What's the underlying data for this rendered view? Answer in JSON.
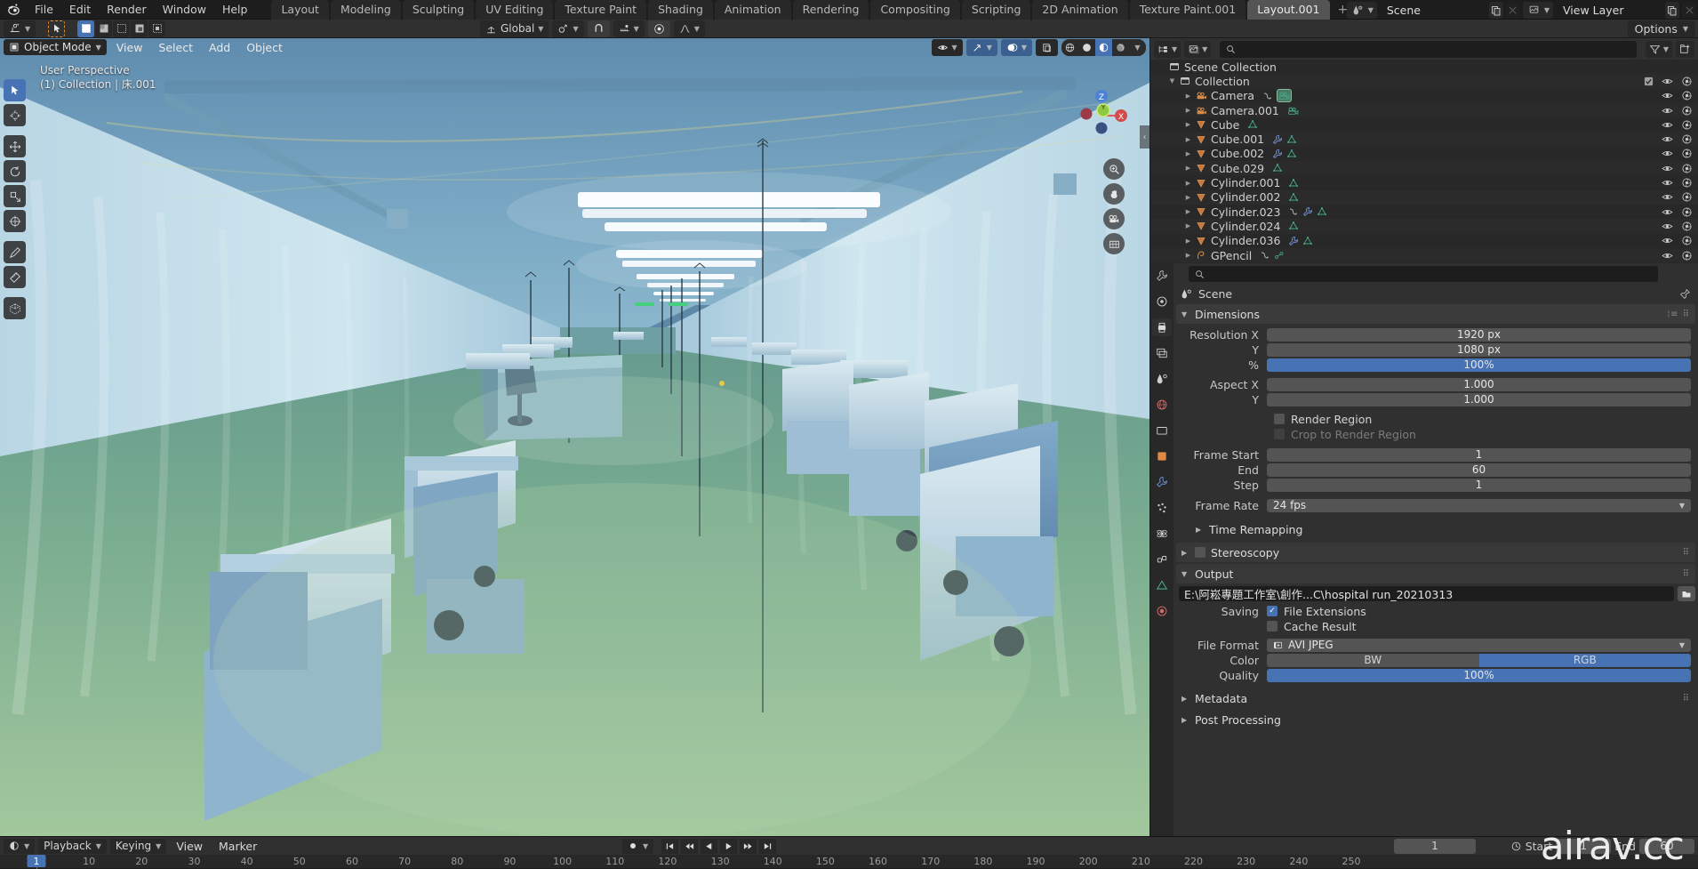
{
  "app": {
    "logo_icon": "blender-logo-icon",
    "menus": [
      "File",
      "Edit",
      "Render",
      "Window",
      "Help"
    ],
    "workspace_tabs": [
      {
        "label": "Layout",
        "active": false
      },
      {
        "label": "Modeling",
        "active": false
      },
      {
        "label": "Sculpting",
        "active": false
      },
      {
        "label": "UV Editing",
        "active": false
      },
      {
        "label": "Texture Paint",
        "active": false
      },
      {
        "label": "Shading",
        "active": false
      },
      {
        "label": "Animation",
        "active": false
      },
      {
        "label": "Rendering",
        "active": false
      },
      {
        "label": "Compositing",
        "active": false
      },
      {
        "label": "Scripting",
        "active": false
      },
      {
        "label": "2D Animation",
        "active": false
      },
      {
        "label": "Texture Paint.001",
        "active": false
      },
      {
        "label": "Layout.001",
        "active": true
      }
    ],
    "add_workspace_label": "+",
    "scene_name": "Scene",
    "view_layer_name": "View Layer",
    "scene_icon": "scene-data-icon",
    "view_layer_icon": "view-layer-icon",
    "new_icon": "duplicate-icon",
    "close_icon": "x-icon"
  },
  "toolsettings": {
    "active_tool_icon": "cursor-tool-icon",
    "select_modes": [
      "set",
      "extend",
      "subtract",
      "invert",
      "intersect"
    ],
    "transform_orientation": "Global",
    "snap_icon": "magnet-icon",
    "pivot_icon": "pivot-icon",
    "proportional_icon": "proportional-edit-icon",
    "falloff_icon": "falloff-curve-icon",
    "options_label": "Options"
  },
  "viewport": {
    "mode": "Object Mode",
    "mode_icon": "object-mode-icon",
    "menus": [
      "View",
      "Select",
      "Add",
      "Object"
    ],
    "overlay_text_line1": "User Perspective",
    "overlay_text_line2": "(1) Collection | 床.001",
    "gizmo_axes": [
      "X",
      "Y",
      "Z"
    ],
    "nav_buttons": [
      "zoom-icon",
      "pan-hand-icon",
      "camera-view-icon",
      "toggle-ortho-icon"
    ],
    "shading_modes": [
      "wireframe",
      "solid",
      "material-preview",
      "rendered"
    ],
    "active_shading": "material-preview",
    "left_tools": [
      {
        "name": "tweak-select-tool",
        "active": true
      },
      {
        "name": "cursor-tool",
        "active": false
      },
      {
        "name": "move-tool",
        "active": false
      },
      {
        "name": "rotate-tool",
        "active": false
      },
      {
        "name": "scale-tool",
        "active": false
      },
      {
        "name": "transform-tool",
        "active": false
      },
      {
        "name": "annotate-tool",
        "active": false
      },
      {
        "name": "measure-tool",
        "active": false
      },
      {
        "name": "add-cube-tool",
        "active": false
      }
    ]
  },
  "outliner": {
    "display_mode_icon": "outliner-display-icon",
    "filter_id_icon": "blender-file-icon",
    "search_placeholder": "",
    "filter_icon": "funnel-icon",
    "new_collection_icon": "new-collection-icon",
    "root": "Scene Collection",
    "collection": {
      "label": "Collection",
      "checkbox": true,
      "eye": true,
      "camera": true
    },
    "items": [
      {
        "name": "Camera",
        "icon": "camera-data-icon",
        "extras": [
          "animation-icon",
          "camera-object-icon"
        ],
        "highlight": true
      },
      {
        "name": "Camera.001",
        "icon": "camera-data-icon",
        "extras": [
          "camera-object-icon"
        ],
        "highlight": false
      },
      {
        "name": "Cube",
        "icon": "mesh-icon",
        "extras": [
          "mesh-data-icon"
        ],
        "highlight": false
      },
      {
        "name": "Cube.001",
        "icon": "mesh-icon",
        "extras": [
          "modifier-wrench-icon",
          "mesh-data-icon"
        ],
        "highlight": false
      },
      {
        "name": "Cube.002",
        "icon": "mesh-icon",
        "extras": [
          "modifier-wrench-icon",
          "mesh-data-icon"
        ],
        "highlight": false
      },
      {
        "name": "Cube.029",
        "icon": "mesh-icon",
        "extras": [
          "mesh-data-icon"
        ],
        "highlight": false
      },
      {
        "name": "Cylinder.001",
        "icon": "mesh-icon",
        "extras": [
          "mesh-data-icon"
        ],
        "highlight": false
      },
      {
        "name": "Cylinder.002",
        "icon": "mesh-icon",
        "extras": [
          "mesh-data-icon"
        ],
        "highlight": false
      },
      {
        "name": "Cylinder.023",
        "icon": "mesh-icon",
        "extras": [
          "animation-icon",
          "modifier-wrench-icon",
          "mesh-data-icon"
        ],
        "highlight": false
      },
      {
        "name": "Cylinder.024",
        "icon": "mesh-icon",
        "extras": [
          "mesh-data-icon"
        ],
        "highlight": false
      },
      {
        "name": "Cylinder.036",
        "icon": "mesh-icon",
        "extras": [
          "modifier-wrench-icon",
          "mesh-data-icon"
        ],
        "highlight": false
      },
      {
        "name": "GPencil",
        "icon": "gpencil-icon",
        "extras": [
          "animation-icon",
          "gpencil-data-icon"
        ],
        "highlight": false
      }
    ]
  },
  "properties": {
    "search_placeholder": "",
    "breadcrumb": "Scene",
    "breadcrumb_icon": "scene-icon",
    "pin_icon": "pin-icon",
    "tabs": [
      {
        "name": "tool-tab",
        "icon": "tool-icon",
        "active": false
      },
      {
        "name": "render-tab",
        "icon": "camera-back-icon",
        "active": false
      },
      {
        "name": "output-tab",
        "icon": "printer-icon",
        "active": true
      },
      {
        "name": "view-layer-tab",
        "icon": "images-icon",
        "active": false
      },
      {
        "name": "scene-tab",
        "icon": "scene-cone-icon",
        "active": false
      },
      {
        "name": "world-tab",
        "icon": "world-globe-icon",
        "active": false
      },
      {
        "name": "collection-tab",
        "icon": "collection-box-icon",
        "active": false
      },
      {
        "name": "object-tab",
        "icon": "orange-square-icon",
        "active": false
      },
      {
        "name": "modifier-tab",
        "icon": "wrench-icon",
        "active": false
      },
      {
        "name": "particles-tab",
        "icon": "particles-icon",
        "active": false
      },
      {
        "name": "physics-tab",
        "icon": "physics-orbit-icon",
        "active": false
      },
      {
        "name": "constraint-tab",
        "icon": "constraint-icon",
        "active": false
      },
      {
        "name": "data-tab",
        "icon": "green-triangle-icon",
        "active": false
      },
      {
        "name": "material-tab",
        "icon": "material-sphere-icon",
        "active": false
      }
    ],
    "dimensions": {
      "title": "Dimensions",
      "rows": [
        {
          "label": "Resolution X",
          "value": "1920 px",
          "style": "normal"
        },
        {
          "label": "Y",
          "value": "1080 px",
          "style": "normal"
        },
        {
          "label": "%",
          "value": "100%",
          "style": "slider"
        },
        {
          "label": "Aspect X",
          "value": "1.000",
          "style": "normal"
        },
        {
          "label": "Y",
          "value": "1.000",
          "style": "normal"
        }
      ],
      "checks": [
        {
          "label": "Render Region",
          "checked": false,
          "disabled": false
        },
        {
          "label": "Crop to Render Region",
          "checked": false,
          "disabled": true
        }
      ],
      "frames": [
        {
          "label": "Frame Start",
          "value": "1"
        },
        {
          "label": "End",
          "value": "60"
        },
        {
          "label": "Step",
          "value": "1"
        }
      ],
      "frame_rate_label": "Frame Rate",
      "frame_rate_value": "24 fps"
    },
    "time_remapping": "Time Remapping",
    "stereoscopy": {
      "label": "Stereoscopy",
      "checked": false
    },
    "output": {
      "title": "Output",
      "path": "E:\\阿崧專題工作室\\創作...C\\hospital run_20210313",
      "folder_icon": "folder-icon",
      "saving_label": "Saving",
      "file_extensions": {
        "label": "File Extensions",
        "checked": true
      },
      "cache_result": {
        "label": "Cache Result",
        "checked": false
      },
      "file_format_label": "File Format",
      "file_format_value": "AVI JPEG",
      "file_format_icon": "movie-icon",
      "color_label": "Color",
      "color_options": [
        "BW",
        "RGB"
      ],
      "color_selected": "RGB",
      "quality_label": "Quality",
      "quality_value": "100%"
    },
    "metadata": "Metadata",
    "post_processing": "Post Processing"
  },
  "timeline": {
    "editor_icon": "timeline-editor-icon",
    "menus": [
      {
        "label": "Playback",
        "dropdown": true
      },
      {
        "label": "Keying",
        "dropdown": true
      },
      {
        "label": "View",
        "dropdown": false
      },
      {
        "label": "Marker",
        "dropdown": false
      }
    ],
    "keying_set_icon": "record-icon",
    "playback_buttons": [
      "jump-start",
      "prev-keyframe",
      "play-reverse",
      "play",
      "next-keyframe",
      "jump-end"
    ],
    "current_frame": "1",
    "start_label": "Start",
    "start_value": "1",
    "end_label": "End",
    "end_value": "60",
    "sync_icon": "sync-icon",
    "ruler_ticks": [
      10,
      20,
      30,
      40,
      50,
      60,
      70,
      80,
      90,
      100,
      110,
      120,
      130,
      140,
      150,
      160,
      170,
      180,
      190,
      200,
      210,
      220,
      230,
      240,
      250
    ],
    "playhead_frame": "1"
  },
  "watermark": "airav.cc",
  "colors": {
    "accent_blue": "#4772b3",
    "header_bg": "#1d1d1d",
    "panel_bg": "#303030",
    "outliner_bg": "#282828",
    "field_bg": "#545454",
    "text": "#d4d4d4",
    "mesh_orange": "#e08a45",
    "data_green": "#4aa884"
  }
}
